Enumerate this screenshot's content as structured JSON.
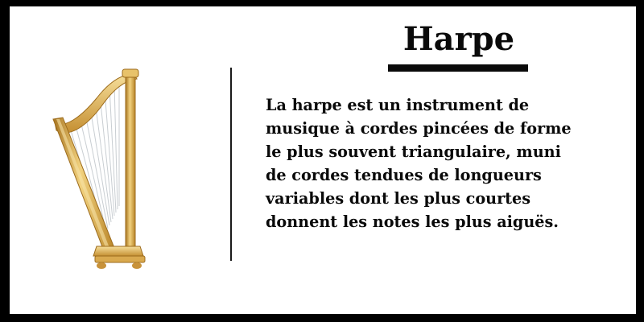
{
  "title": "Harpe",
  "description_lines": [
    "La harpe est un instrument de",
    "musique à cordes pincées de forme",
    "le plus souvent triangulaire, muni",
    "de cordes tendues de longueurs",
    "variables dont les plus courtes",
    "donnent les notes les plus aiguës."
  ],
  "image": {
    "icon": "harp-icon",
    "colors": {
      "frame": "#d7a84a",
      "frame_dark": "#a87520",
      "strings": "#cfd3d6",
      "highlight": "#f7e3a6"
    }
  },
  "colors": {
    "background": "#ffffff",
    "border": "#000000",
    "text": "#0a0a0a"
  }
}
